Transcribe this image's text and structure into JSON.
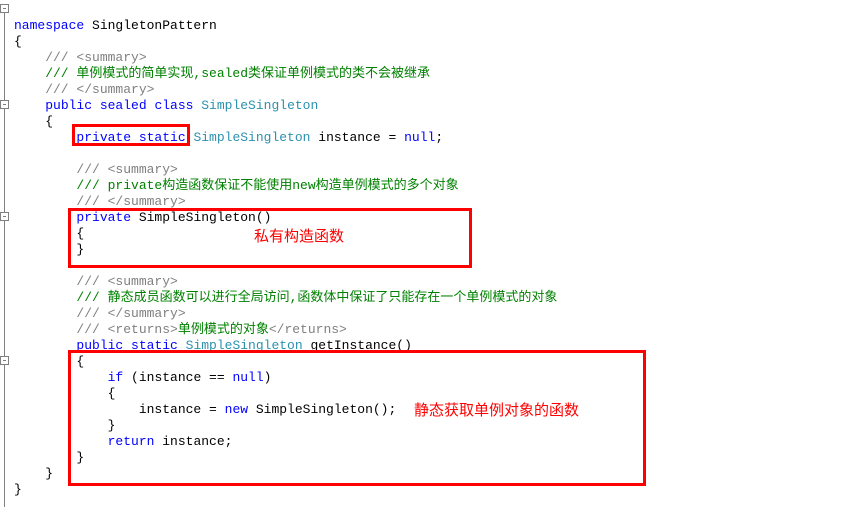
{
  "ns_kw": "namespace",
  "ns_name": " SingletonPattern",
  "ob": "{",
  "cb": "}",
  "c_open": "    /// <summary>",
  "c_doc1": "    /// 单例模式的简单实现,sealed类保证单例模式的类不会被继承",
  "c_close": "    /// </summary>",
  "public": "public",
  "sealed": " sealed",
  "class_kw": " class",
  "class_name": " SimpleSingleton",
  "ob2": "    {",
  "private": "private",
  "static": " static",
  "field_type": " SimpleSingleton",
  "instance": " instance = ",
  "null_kw": "null",
  "semi": ";",
  "ctor_open": "        /// <summary>",
  "ctor_doc": "        /// private构造函数保证不能使用new构造单例模式的多个对象",
  "ctor_close": "        /// </summary>",
  "ctor_sig1": "private",
  "ctor_sig2": " SimpleSingleton()",
  "ob3": "        {",
  "cb3": "        }",
  "get_open": "        /// <summary>",
  "get_doc": "        /// 静态成员函数可以进行全局访问,函数体中保证了只能存在一个单例模式的对象",
  "get_close": "        /// </summary>",
  "returns_pre": "        /// <returns>",
  "returns_txt": "单例模式的对象",
  "returns_post": "</returns>",
  "getinst_type": " SimpleSingleton",
  "getinst_name": " getInstance()",
  "ob4": "        {",
  "if_kw": "if",
  "if_cond": " (instance == ",
  "null2": "null",
  "paren": ")",
  "ob5": "            {",
  "assign": "                instance = ",
  "new_kw": "new",
  "ctor_call": " SimpleSingleton();",
  "cb5": "            }",
  "return_kw": "return",
  "return_val": " instance;",
  "cb4": "        }",
  "cb2": "    }",
  "annot1": "私有构造函数",
  "annot2": "静态获取单例对象的函数"
}
